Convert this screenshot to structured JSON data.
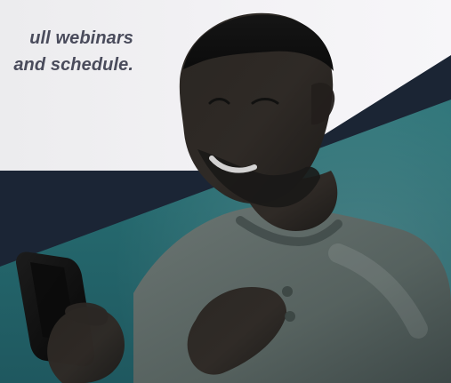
{
  "hero": {
    "headline_lines": [
      "ull webinars",
      "and schedule."
    ]
  },
  "colors": {
    "light_bg": "#f3f2f5",
    "navy": "#1b2535",
    "teal": "#2f7d80",
    "headline_text": "#4a4c5c"
  },
  "icons": {
    "smartphone": "smartphone-icon"
  }
}
